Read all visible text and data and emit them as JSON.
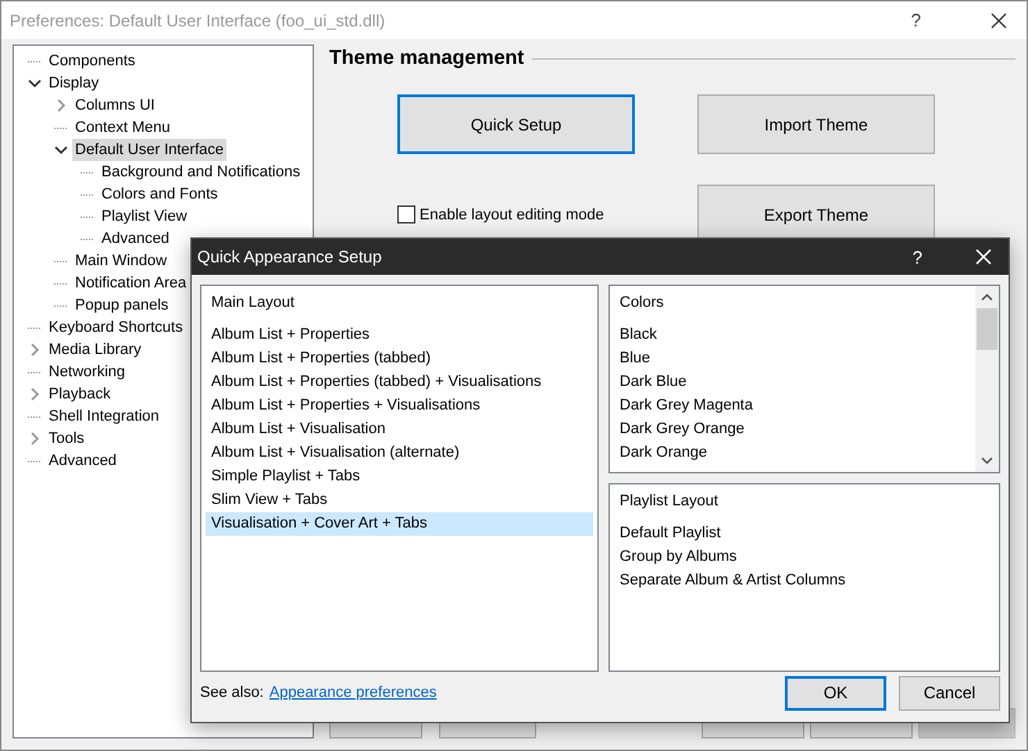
{
  "window": {
    "title": "Preferences: Default User Interface (foo_ui_std.dll)",
    "help": "?"
  },
  "tree": [
    {
      "label": "Components",
      "selected": false
    },
    {
      "label": "Display",
      "selected": false,
      "expanded": true,
      "children": [
        {
          "label": "Columns UI",
          "selected": false,
          "expanded": false
        },
        {
          "label": "Context Menu",
          "selected": false
        },
        {
          "label": "Default User Interface",
          "selected": true,
          "expanded": true,
          "children": [
            {
              "label": "Background and Notifications",
              "selected": false
            },
            {
              "label": "Colors and Fonts",
              "selected": false
            },
            {
              "label": "Playlist View",
              "selected": false
            },
            {
              "label": "Advanced",
              "selected": false
            }
          ]
        },
        {
          "label": "Main Window",
          "selected": false
        },
        {
          "label": "Notification Area",
          "selected": false
        },
        {
          "label": "Popup panels",
          "selected": false
        }
      ]
    },
    {
      "label": "Keyboard Shortcuts",
      "selected": false
    },
    {
      "label": "Media Library",
      "selected": false,
      "expanded": false
    },
    {
      "label": "Networking",
      "selected": false
    },
    {
      "label": "Playback",
      "selected": false,
      "expanded": false
    },
    {
      "label": "Shell Integration",
      "selected": false
    },
    {
      "label": "Tools",
      "selected": false,
      "expanded": false
    },
    {
      "label": "Advanced",
      "selected": false
    }
  ],
  "theme": {
    "heading": "Theme management",
    "buttons": [
      {
        "label": "Quick Setup",
        "focused": true
      },
      {
        "label": "Import Theme",
        "focused": false
      }
    ],
    "layout_editing": {
      "label": "Enable layout editing mode",
      "checked": false
    },
    "export_button": {
      "label": "Export Theme",
      "focused": false
    }
  },
  "bottom_buttons": [
    {
      "disabled": false
    },
    {
      "disabled": false
    },
    {
      "disabled": false
    },
    {
      "disabled": false
    },
    {
      "disabled": true
    }
  ],
  "dialog": {
    "title": "Quick Appearance Setup",
    "help": "?",
    "main_layout": {
      "header": "Main Layout",
      "items": [
        {
          "label": "Album List + Properties",
          "selected": false
        },
        {
          "label": "Album List + Properties (tabbed)",
          "selected": false
        },
        {
          "label": "Album List + Properties (tabbed) + Visualisations",
          "selected": false
        },
        {
          "label": "Album List + Properties + Visualisations",
          "selected": false
        },
        {
          "label": "Album List + Visualisation",
          "selected": false
        },
        {
          "label": "Album List + Visualisation (alternate)",
          "selected": false
        },
        {
          "label": "Simple Playlist + Tabs",
          "selected": false
        },
        {
          "label": "Slim View + Tabs",
          "selected": false
        },
        {
          "label": "Visualisation + Cover Art + Tabs",
          "selected": true
        }
      ]
    },
    "colors": {
      "header": "Colors",
      "items": [
        {
          "label": "Black",
          "selected": false
        },
        {
          "label": "Blue",
          "selected": false
        },
        {
          "label": "Dark Blue",
          "selected": false
        },
        {
          "label": "Dark Grey Magenta",
          "selected": false
        },
        {
          "label": "Dark Grey Orange",
          "selected": false
        },
        {
          "label": "Dark Orange",
          "selected": false
        }
      ]
    },
    "playlist_layout": {
      "header": "Playlist Layout",
      "items": [
        {
          "label": "Default Playlist",
          "selected": false
        },
        {
          "label": "Group by Albums",
          "selected": false
        },
        {
          "label": "Separate Album & Artist Columns",
          "selected": false
        }
      ]
    },
    "see_also": "See also:",
    "link": "Appearance preferences",
    "buttons": [
      {
        "label": "OK",
        "focused": true
      },
      {
        "label": "Cancel",
        "focused": false
      }
    ]
  }
}
